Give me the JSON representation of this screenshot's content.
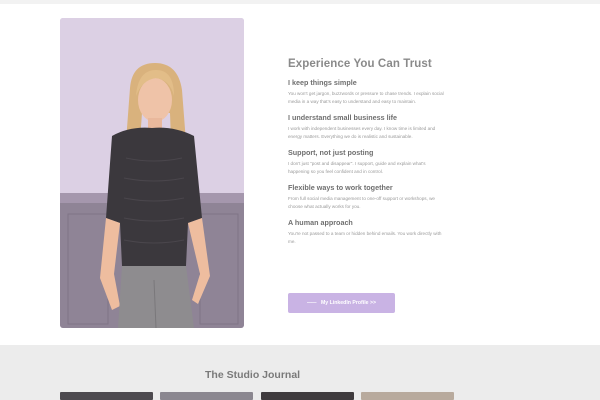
{
  "about": {
    "heading": "Experience You Can Trust",
    "points": [
      {
        "title": "I keep things simple",
        "text": "You won't get jargon, buzzwords or pressure to chase trends. I explain social media in a way that's easy to understand and easy to maintain."
      },
      {
        "title": "I understand small business life",
        "text": "I work with independent businesses every day. I know time is limited and energy matters. Everything we do is realistic and sustainable."
      },
      {
        "title": "Support, not just posting",
        "text": "I don't just \"post and disappear\". I support, guide and explain what's happening so you feel confident and in control."
      },
      {
        "title": "Flexible ways to work together",
        "text": "From full social media management to one-off support or workshops, we choose what actually works for you."
      },
      {
        "title": "A human approach",
        "text": "You're not passed to a team or hidden behind emails. You work directly with me."
      }
    ],
    "cta_label": "My LinkedIn Profile >>"
  },
  "journal": {
    "heading": "The Studio Journal"
  },
  "colors": {
    "accent": "#c9b3e4",
    "photo_background": "#d9cbe0",
    "journal_band": "#ececec"
  }
}
